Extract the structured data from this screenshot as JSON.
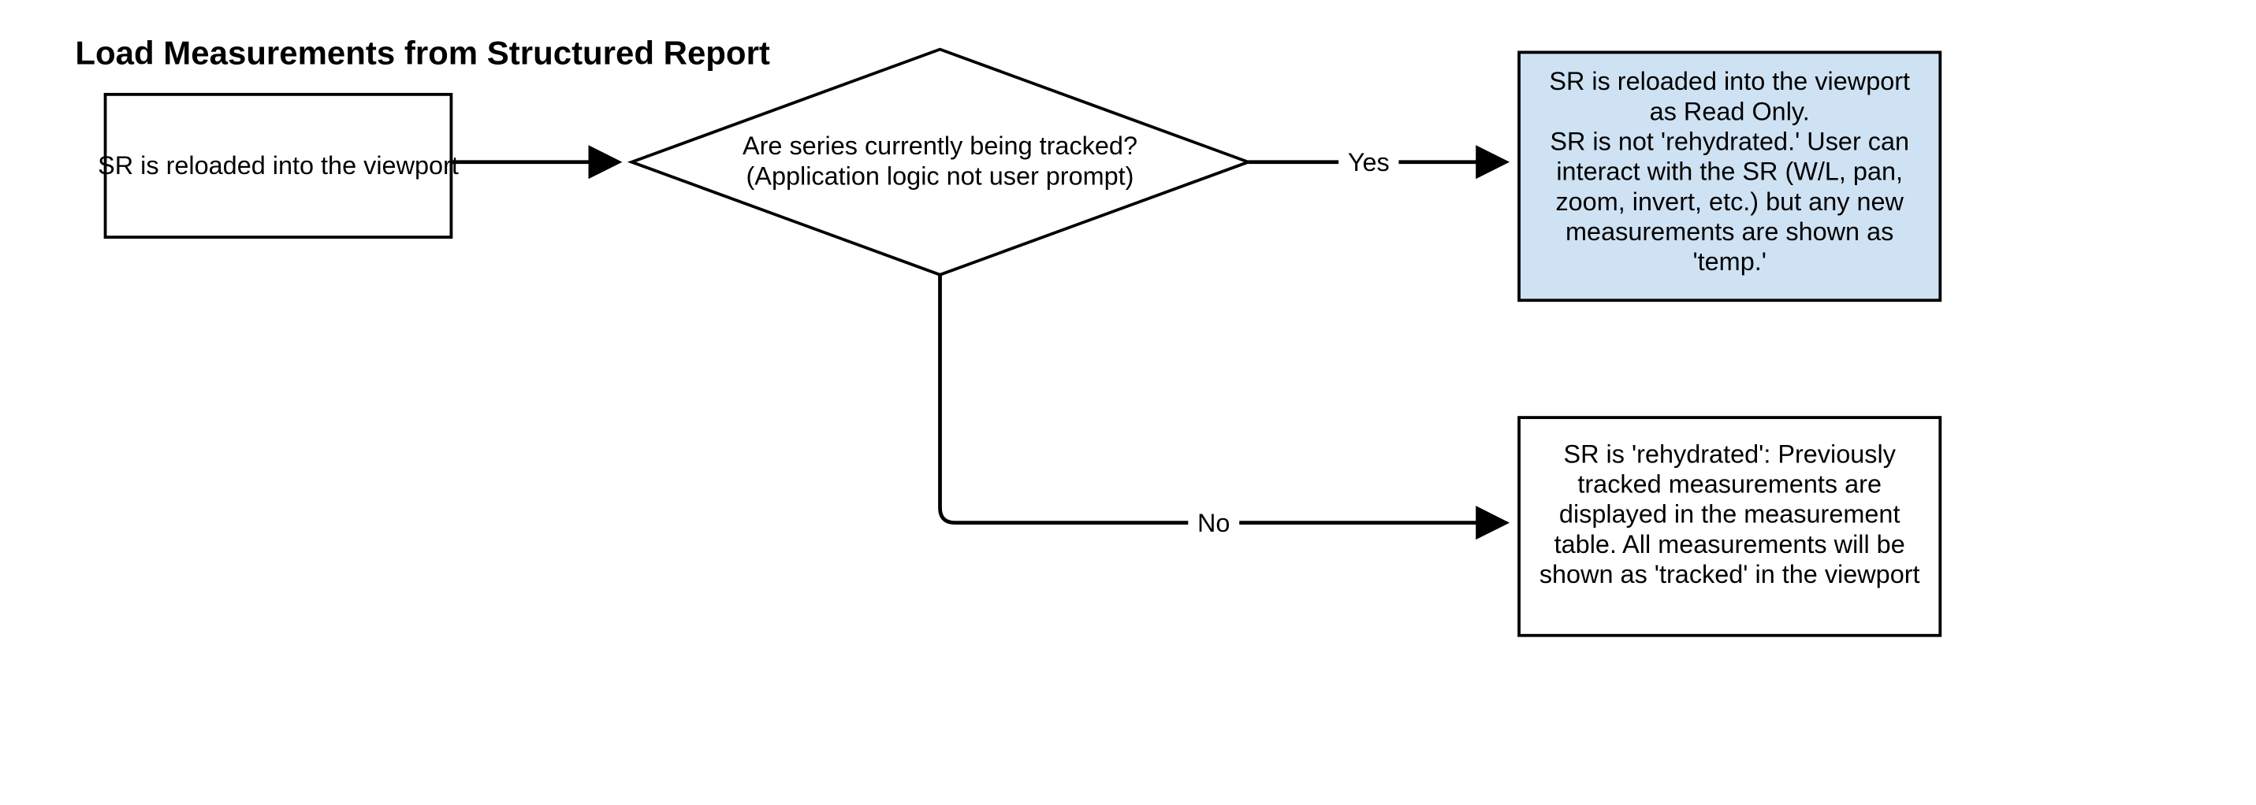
{
  "title": "Load Measurements from Structured Report",
  "nodes": {
    "start": {
      "text": "SR is reloaded into the viewport"
    },
    "decision": {
      "line1": "Are series currently being tracked?",
      "line2": "(Application logic not user prompt)"
    },
    "yes_result": {
      "line1": "SR is reloaded into the viewport",
      "line2": "as Read Only.",
      "line3": "SR is not 'rehydrated.' User can",
      "line4": "interact with the SR (W/L, pan,",
      "line5": "zoom, invert, etc.) but any new",
      "line6": "measurements are shown as",
      "line7": "'temp.'"
    },
    "no_result": {
      "line1": "SR is 'rehydrated': Previously",
      "line2": "tracked measurements are",
      "line3": "displayed in the measurement",
      "line4": "table. All measurements will be",
      "line5": "shown as 'tracked' in the viewport"
    }
  },
  "edges": {
    "yes": "Yes",
    "no": "No"
  }
}
